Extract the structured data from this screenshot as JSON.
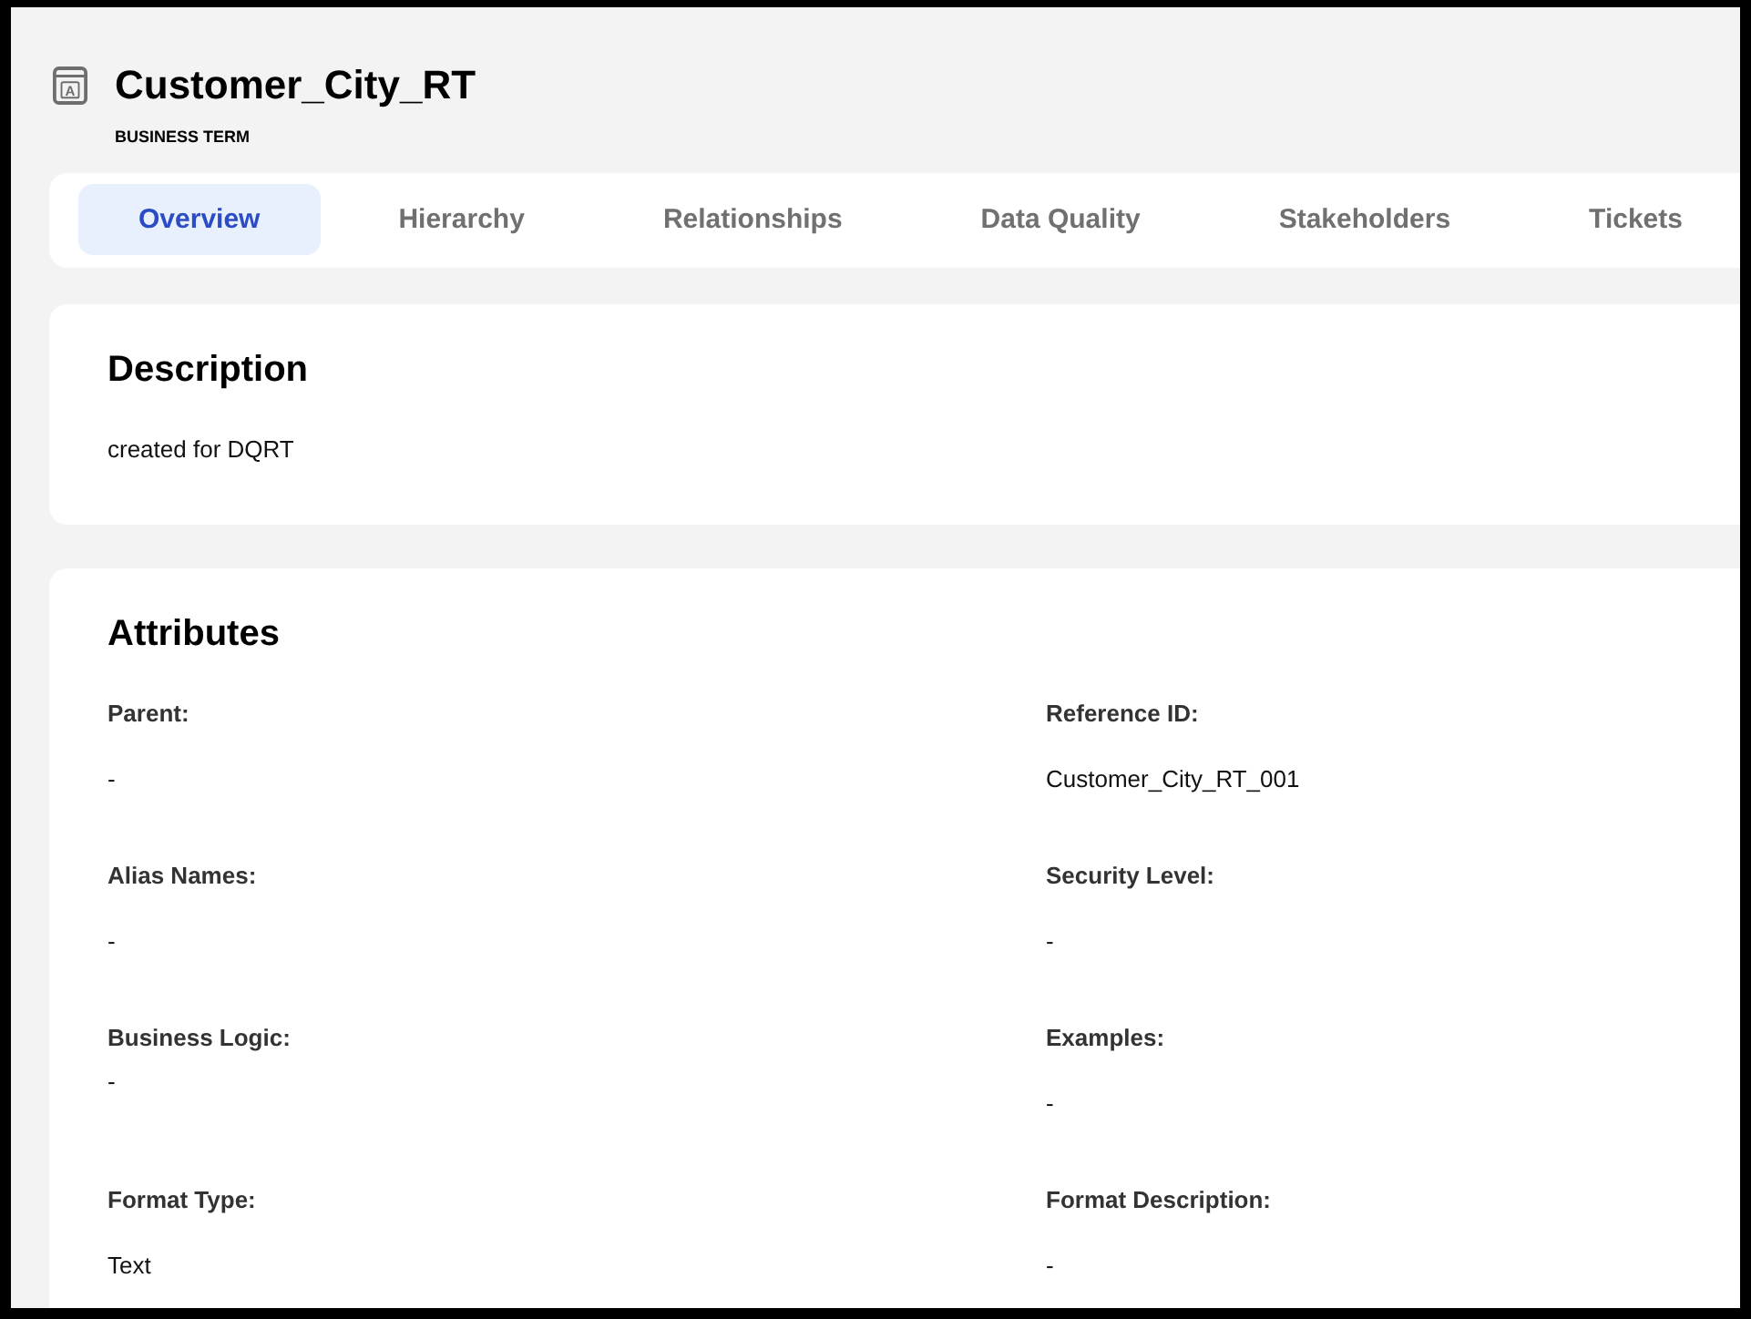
{
  "header": {
    "icon_letter": "A",
    "title": "Customer_City_RT",
    "subtitle": "BUSINESS TERM"
  },
  "tabs": [
    {
      "label": "Overview",
      "selected": true
    },
    {
      "label": "Hierarchy",
      "selected": false
    },
    {
      "label": "Relationships",
      "selected": false
    },
    {
      "label": "Data Quality",
      "selected": false
    },
    {
      "label": "Stakeholders",
      "selected": false
    },
    {
      "label": "Tickets",
      "selected": false
    }
  ],
  "description": {
    "title": "Description",
    "text": "created for DQRT"
  },
  "attributes": {
    "title": "Attributes",
    "fields": [
      {
        "label": "Parent:",
        "value": "-",
        "kind": "plain"
      },
      {
        "label": "Reference ID:",
        "value": "Customer_City_RT_001",
        "kind": "plain"
      },
      {
        "label": "Alias Names:",
        "value": "-",
        "kind": "plain"
      },
      {
        "label": "Security Level:",
        "value": "-",
        "kind": "plain"
      },
      {
        "label": "Business Logic:",
        "value": "-",
        "kind": "rich"
      },
      {
        "label": "Examples:",
        "value": "-",
        "kind": "plain"
      },
      {
        "label": "Format Type:",
        "value": "Text",
        "kind": "plain"
      },
      {
        "label": "Format Description:",
        "value": "-",
        "kind": "plain"
      }
    ]
  }
}
